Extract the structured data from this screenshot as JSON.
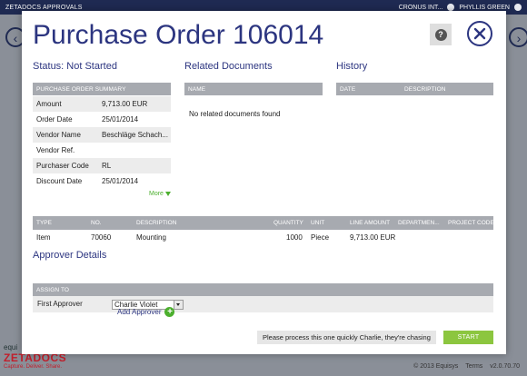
{
  "app": {
    "name": "ZETADOCS APPROVALS",
    "company": "CRONUS INT...",
    "user": "PHYLLIS GREEN",
    "footer": {
      "copyright": "© 2013 Equisys",
      "terms": "Terms",
      "version": "v2.0.70.70"
    },
    "logo": {
      "small": "equi",
      "big": "ZETADOCS",
      "tagline": "Capture. Deliver. Share."
    }
  },
  "modal": {
    "title": "Purchase Order 106014",
    "status": "Status: Not Started",
    "related_title": "Related Documents",
    "history_title": "History",
    "summary_header": "PURCHASE ORDER SUMMARY",
    "summary": [
      {
        "label": "Amount",
        "value": "9,713.00 EUR"
      },
      {
        "label": "Order Date",
        "value": "25/01/2014"
      },
      {
        "label": "Vendor Name",
        "value": "Beschläge Schach..."
      },
      {
        "label": "Vendor Ref.",
        "value": ""
      },
      {
        "label": "Purchaser Code",
        "value": "RL"
      },
      {
        "label": "Discount Date",
        "value": "25/01/2014"
      }
    ],
    "more_label": "More",
    "related_header": "NAME",
    "no_related": "No related documents found",
    "history_headers": [
      "DATE",
      "DESCRIPTION"
    ],
    "lines_headers": [
      "TYPE",
      "NO.",
      "DESCRIPTION",
      "QUANTITY",
      "UNIT",
      "LINE AMOUNT",
      "DEPARTMEN...",
      "PROJECT CODE"
    ],
    "lines": [
      {
        "type": "Item",
        "no": "70060",
        "description": "Mounting",
        "quantity": "1000",
        "unit": "Piece",
        "line_amount": "9,713.00 EUR",
        "department": "",
        "project_code": ""
      }
    ],
    "approver_title": "Approver Details",
    "assign_header": "ASSIGN TO",
    "first_approver_label": "First Approver",
    "first_approver_value": "Charlie Violet",
    "add_approver_label": "Add Approver",
    "comment_value": "Please process this one quickly Charlie, they're chasing",
    "start_label": "START"
  },
  "colors": {
    "accent": "#2c3580",
    "header_gray": "#a7aab0",
    "green": "#8cc63f",
    "topbar": "#1f2a52"
  }
}
